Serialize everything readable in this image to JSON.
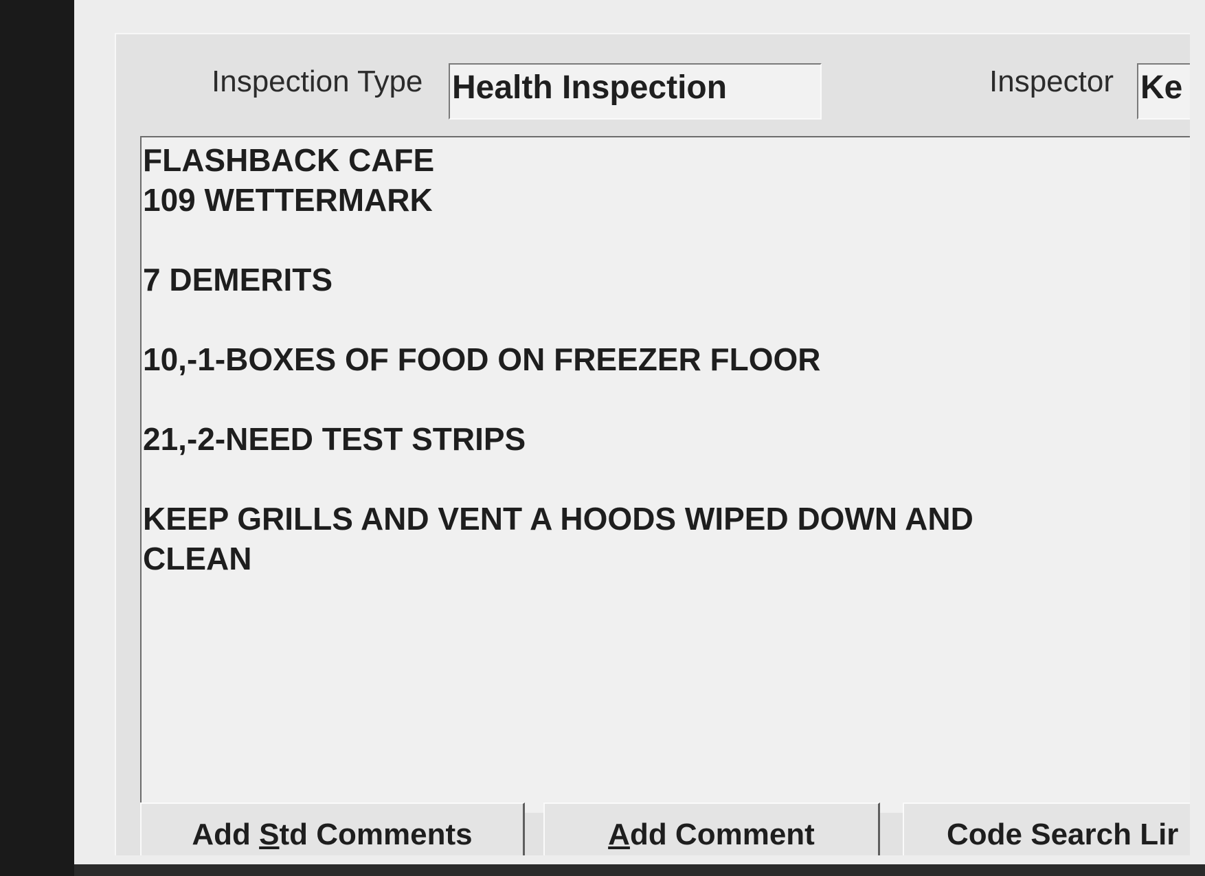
{
  "header": {
    "inspection_type_label": "Inspection Type",
    "inspection_type_value": "Health Inspection",
    "inspector_label": "Inspector",
    "inspector_value": "Ke"
  },
  "comments": {
    "lines": [
      "FLASHBACK CAFE",
      "109 WETTERMARK",
      "7 DEMERITS",
      "10,-1-BOXES OF FOOD ON FREEZER FLOOR",
      "21,-2-NEED TEST STRIPS",
      "KEEP GRILLS AND VENT A HOODS WIPED DOWN AND",
      "CLEAN"
    ]
  },
  "buttons": {
    "add_std_comments": {
      "pre": "Add ",
      "mnemonic": "S",
      "post": "td Comments"
    },
    "add_comment": {
      "pre": "",
      "mnemonic": "A",
      "post": "dd Comment"
    },
    "code_search": {
      "label": "Code Search Lir"
    }
  }
}
